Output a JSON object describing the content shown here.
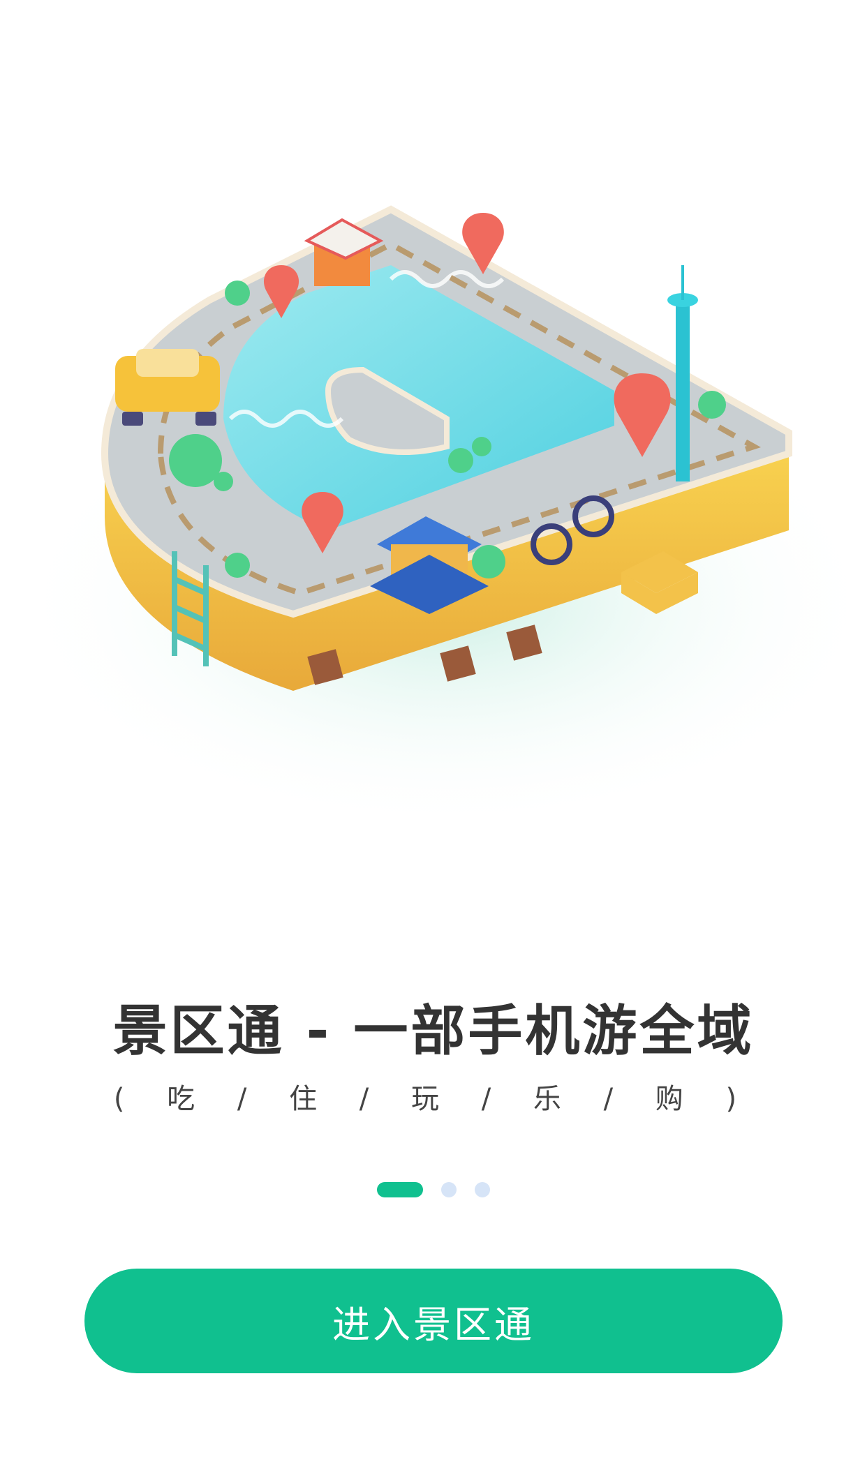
{
  "onboarding": {
    "title": "景区通 - 一部手机游全域",
    "subtitle": "( 吃 / 住 / 玩 / 乐 / 购 )",
    "page_indicator": {
      "count": 3,
      "active_index": 0
    },
    "enter_button_label": "进入景区通"
  },
  "colors": {
    "accent": "#10c08f",
    "inactive_dot": "#d6e4f7",
    "title_text": "#333333"
  },
  "illustration": {
    "subject": "isometric letter-shaped scenic park map with road, water, pins, tower, pagoda, car, cyclist, runner"
  }
}
